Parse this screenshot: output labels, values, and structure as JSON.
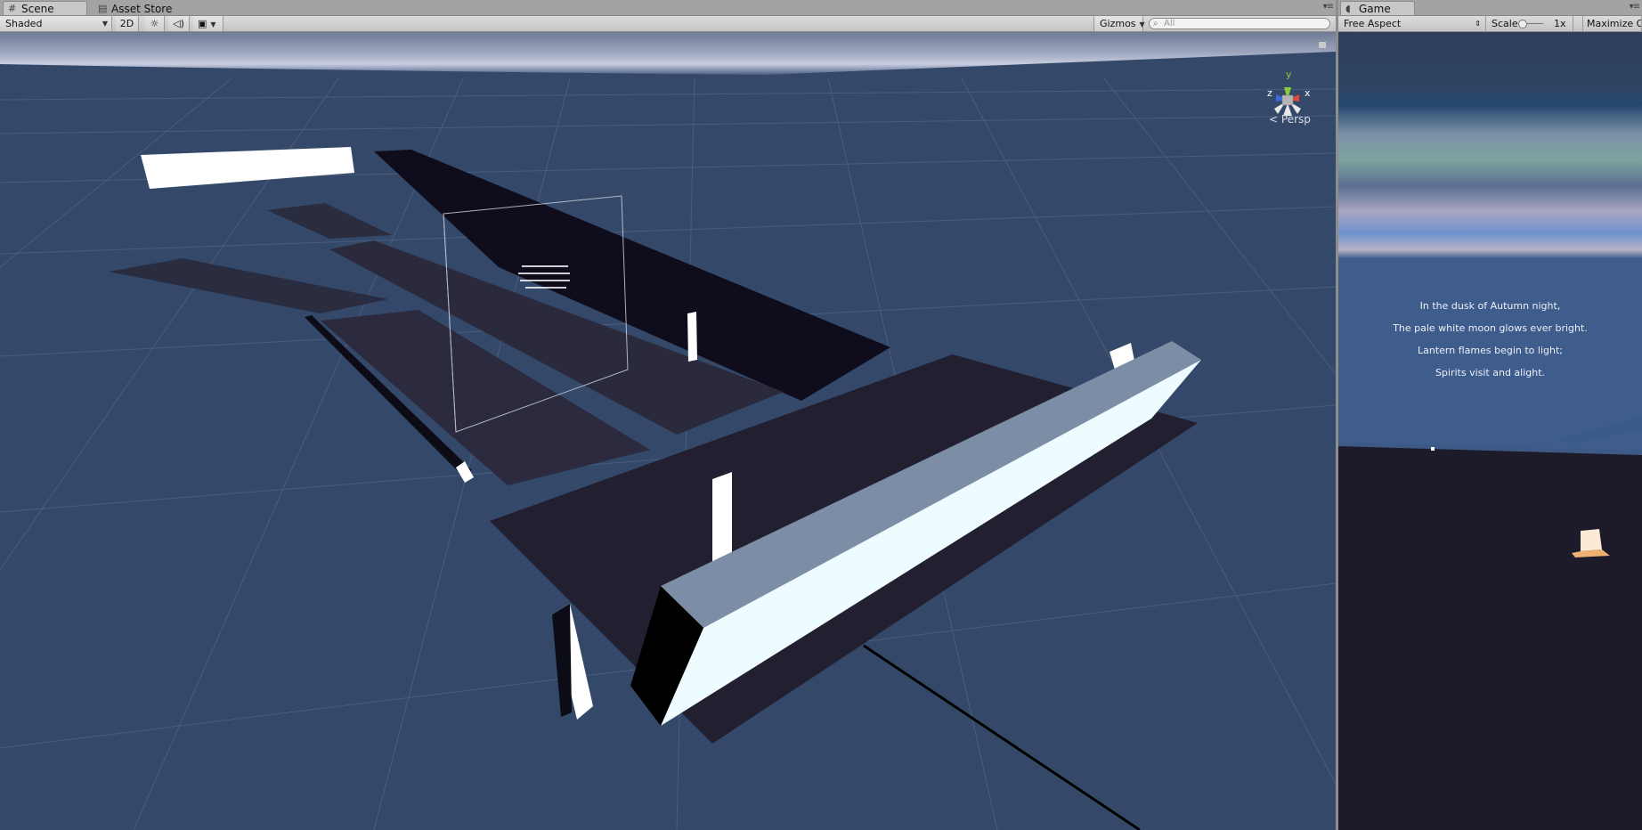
{
  "scene": {
    "tabs": [
      {
        "label": "Scene",
        "icon": "hash-icon"
      },
      {
        "label": "Asset Store",
        "icon": "bag-icon"
      }
    ],
    "toolbar": {
      "shading_mode": "Shaded",
      "mode_2d": "2D",
      "gizmos_label": "Gizmos",
      "search_placeholder": "All"
    },
    "view": {
      "projection_label": "Persp",
      "axis_labels": {
        "y": "y",
        "x": "x",
        "z": "z"
      },
      "skybox_color": "#34496a"
    }
  },
  "game": {
    "tab_label": "Game",
    "aspect_label": "Free Aspect",
    "scale_label": "Scale",
    "scale_value": "1x",
    "maximize_label": "Maximize O",
    "poem": [
      "In the dusk of Autumn night,",
      "The pale white moon glows ever bright.",
      "Lantern flames begin to light;",
      "Spirits visit and alight."
    ]
  },
  "colors": {
    "panel_bg": "#c2c2c2",
    "scene_bg": "#34496a",
    "game_bg": "#1c1a2a",
    "axis_x": "#e04a3a",
    "axis_y": "#8ccc3c",
    "axis_z": "#3a6ae0"
  }
}
